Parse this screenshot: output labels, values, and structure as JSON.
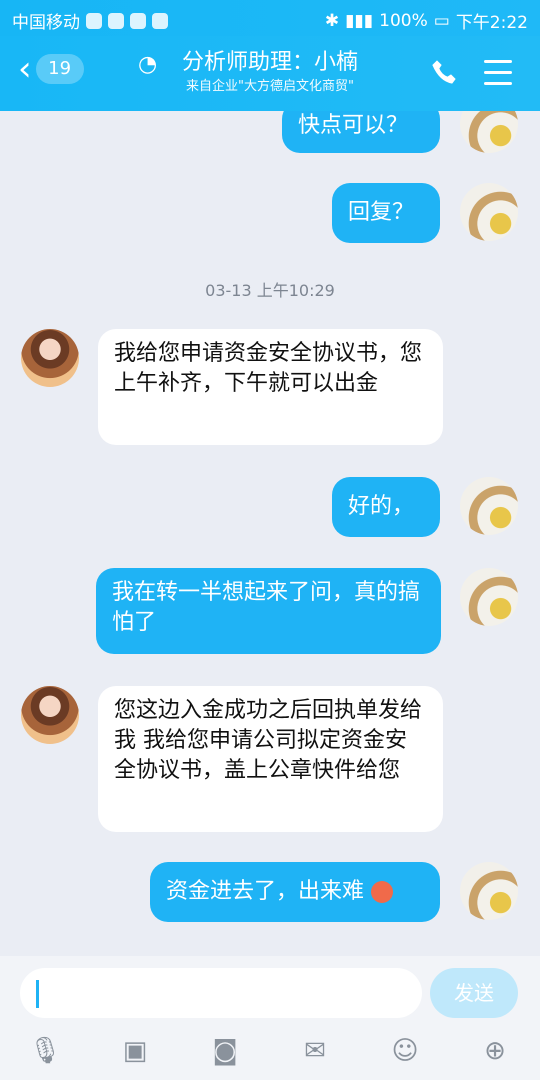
{
  "statusbar": {
    "carrier": "中国移动",
    "battery": "100%",
    "time": "下午2:22"
  },
  "header": {
    "back_badge": "19",
    "title": "分析师助理：小楠",
    "subtitle": "来自企业\"大方德启文化商贸\""
  },
  "chat": {
    "messages": [
      {
        "side": "me",
        "text": "快点可以？"
      },
      {
        "side": "me",
        "text": "回复？"
      },
      {
        "side": "time",
        "text": "03-13 上午10:29"
      },
      {
        "side": "them",
        "text": "我给您申请资金安全协议书，您上午补齐，下午就可以出金"
      },
      {
        "side": "me",
        "text": "好的，"
      },
      {
        "side": "me",
        "text": "我在转一半想起来了问，真的搞怕了"
      },
      {
        "side": "them",
        "text": "您这边入金成功之后回执单发给我  我给您申请公司拟定资金安全协议书，盖上公章快件给您"
      },
      {
        "side": "me",
        "text": "资金进去了，出来难"
      }
    ]
  },
  "input": {
    "send_label": "发送"
  },
  "colors": {
    "accent": "#1fb3f5",
    "header": "#18b7f6",
    "background": "#eaedf4"
  },
  "toolbar_icons": [
    "mic-icon",
    "image-icon",
    "camera-icon",
    "red-packet-icon",
    "emoji-icon",
    "plus-icon"
  ]
}
